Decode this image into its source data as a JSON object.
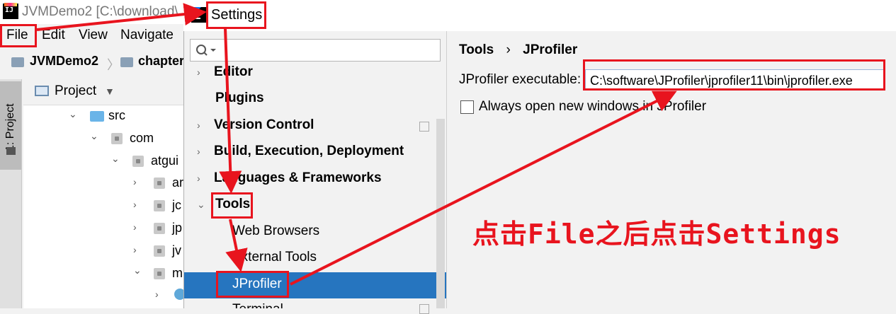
{
  "ide": {
    "window_title": "JVMDemo2 [C:\\download\\",
    "menu": {
      "file": "File",
      "edit": "Edit",
      "view": "View",
      "navigate": "Navigate"
    },
    "breadcrumbs": [
      "JVMDemo2",
      "chapter"
    ],
    "side_tab": "1: Project",
    "project_header": "Project",
    "tree": [
      {
        "label": "src"
      },
      {
        "label": "com"
      },
      {
        "label": "atgui"
      },
      {
        "label": "ar"
      },
      {
        "label": "jc"
      },
      {
        "label": "jp"
      },
      {
        "label": "jv"
      },
      {
        "label": "m"
      }
    ]
  },
  "settings": {
    "title": "Settings",
    "search_placeholder": "",
    "items": [
      {
        "label": "Editor"
      },
      {
        "label": "Plugins"
      },
      {
        "label": "Version Control"
      },
      {
        "label": "Build, Execution, Deployment"
      },
      {
        "label": "Languages & Frameworks"
      },
      {
        "label": "Tools"
      },
      {
        "label": "Web Browsers"
      },
      {
        "label": "External Tools"
      },
      {
        "label": "JProfiler"
      },
      {
        "label": "Terminal"
      }
    ],
    "breadcrumb": {
      "parent": "Tools",
      "sep": "›",
      "current": "JProfiler"
    },
    "exe_label": "JProfiler executable:",
    "exe_value": "C:\\software\\JProfiler\\jprofiler11\\bin\\jprofiler.exe",
    "checkbox_label": "Always open new windows in JProfiler"
  },
  "annotation": {
    "text": "点击File之后点击Settings",
    "color": "#e8141e"
  },
  "colors": {
    "selection": "#2675bf",
    "annotation": "#e8141e"
  }
}
